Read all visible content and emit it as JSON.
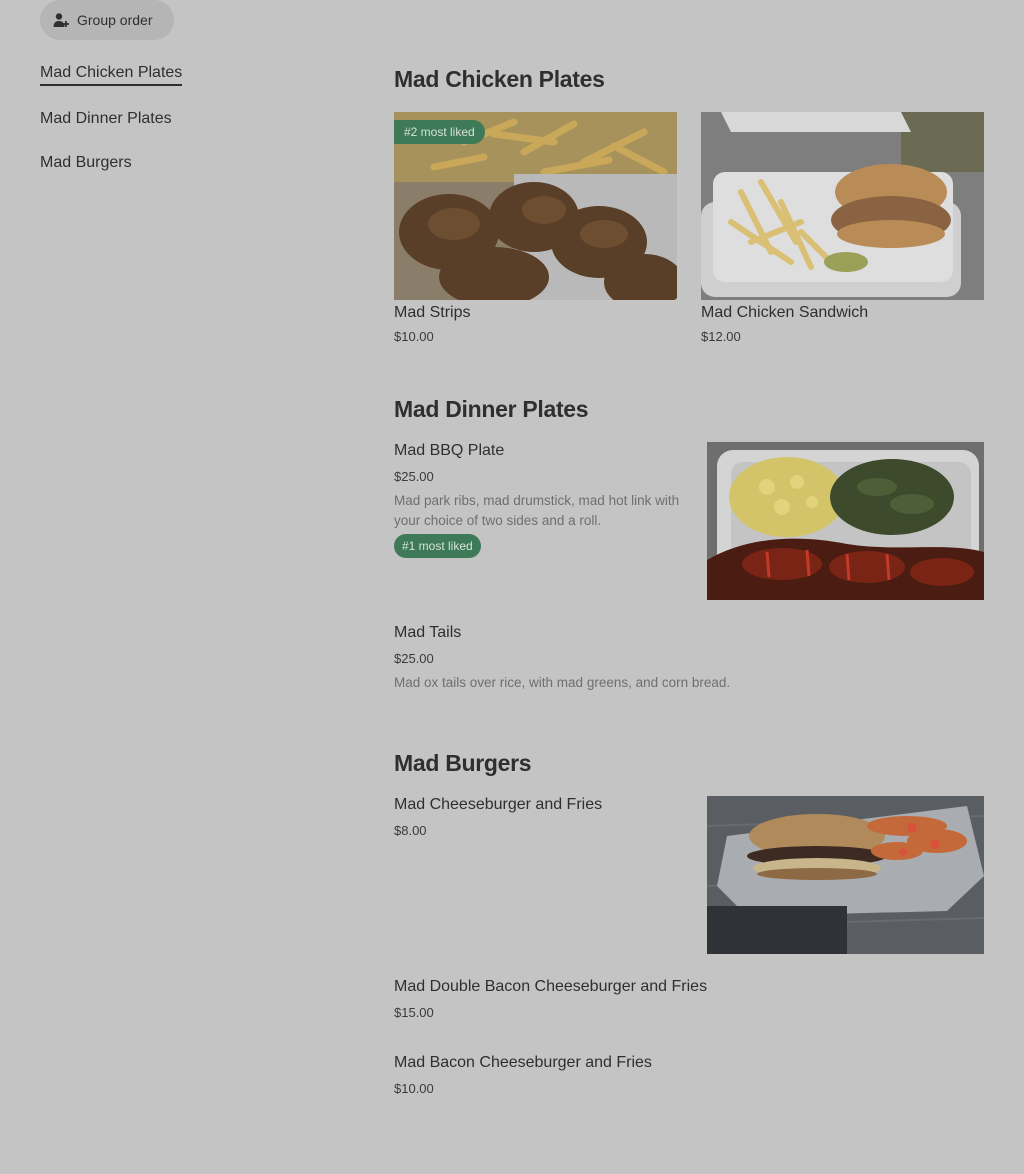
{
  "group_order": {
    "label": "Group order",
    "icon": "person-add-icon"
  },
  "sidebar": {
    "items": [
      {
        "label": "Mad Chicken Plates",
        "active": true
      },
      {
        "label": "Mad Dinner Plates",
        "active": false
      },
      {
        "label": "Mad Burgers",
        "active": false
      }
    ]
  },
  "sections": [
    {
      "title": "Mad Chicken Plates",
      "items": [
        {
          "name": "Mad Strips",
          "price": "$10.00",
          "badge": "#2 most liked"
        },
        {
          "name": "Mad Chicken Sandwich",
          "price": "$12.00"
        }
      ]
    },
    {
      "title": "Mad Dinner Plates",
      "items": [
        {
          "name": "Mad BBQ Plate",
          "price": "$25.00",
          "description": "Mad park ribs, mad drumstick, mad hot link with your choice of two sides and a roll.",
          "badge": "#1 most liked"
        },
        {
          "name": "Mad Tails",
          "price": "$25.00",
          "description": "Mad ox tails over rice, with mad greens, and corn bread."
        }
      ]
    },
    {
      "title": "Mad Burgers",
      "items": [
        {
          "name": "Mad Cheeseburger and Fries",
          "price": "$8.00"
        },
        {
          "name": "Mad Double Bacon Cheeseburger and Fries",
          "price": "$15.00"
        },
        {
          "name": "Mad Bacon Cheeseburger and Fries",
          "price": "$10.00"
        }
      ]
    }
  ],
  "colors": {
    "page_bg": "#c4c4c4",
    "badge_bg": "#3e7a57",
    "text": "#2f2f2f"
  }
}
